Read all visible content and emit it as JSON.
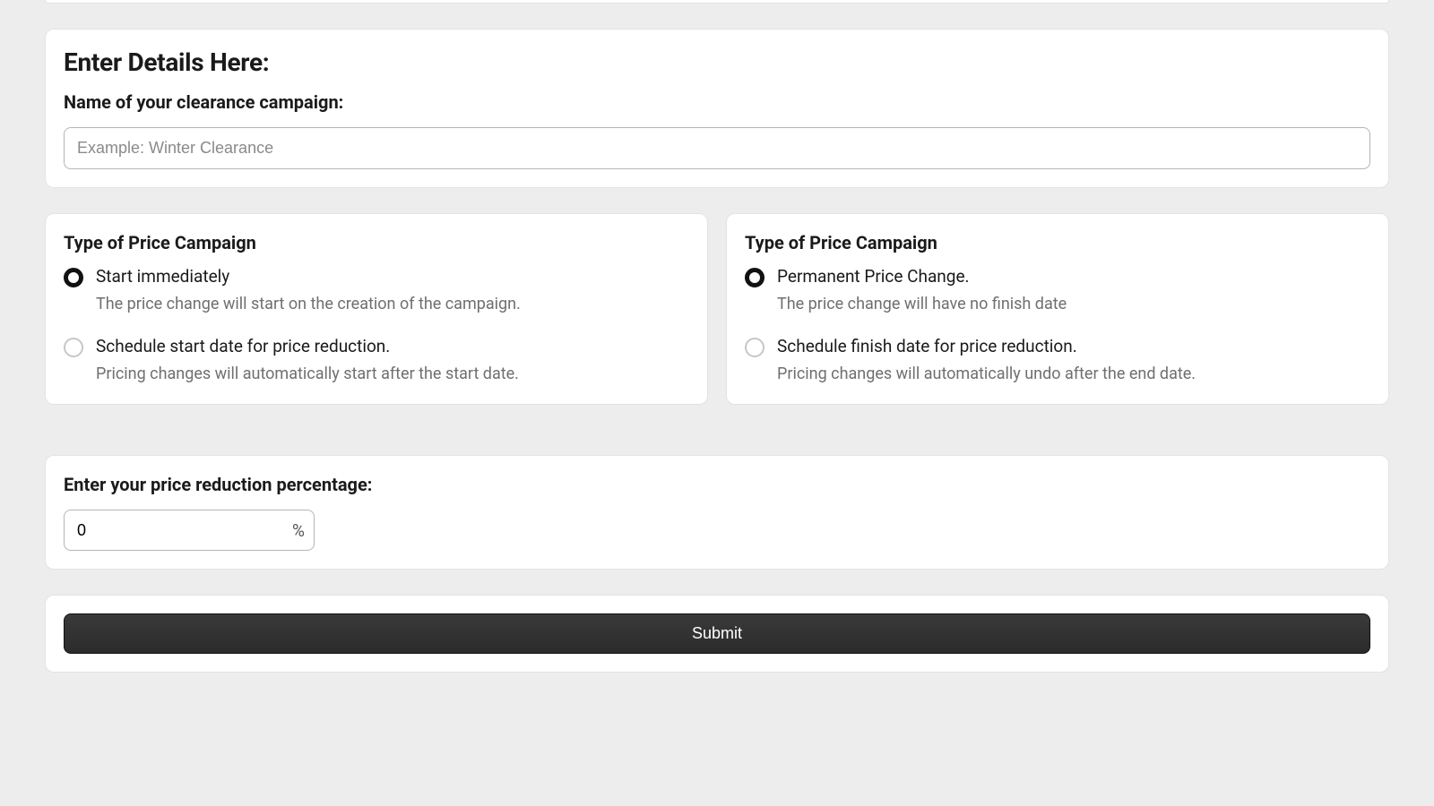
{
  "details": {
    "heading": "Enter Details Here:",
    "name_label": "Name of your clearance campaign:",
    "name_placeholder": "Example: Winter Clearance",
    "name_value": ""
  },
  "start": {
    "title": "Type of Price Campaign",
    "options": [
      {
        "label": "Start immediately",
        "desc": "The price change will start on the creation of the campaign.",
        "selected": true
      },
      {
        "label": "Schedule start date for price reduction.",
        "desc": "Pricing changes will automatically start after the start date.",
        "selected": false
      }
    ]
  },
  "finish": {
    "title": "Type of Price Campaign",
    "options": [
      {
        "label": "Permanent Price Change.",
        "desc": "The price change will have no finish date",
        "selected": true
      },
      {
        "label": "Schedule finish date for price reduction.",
        "desc": "Pricing changes will automatically undo after the end date.",
        "selected": false
      }
    ]
  },
  "percentage": {
    "label": "Enter your price reduction percentage:",
    "value": "0",
    "suffix": "%"
  },
  "submit": {
    "label": "Submit"
  }
}
